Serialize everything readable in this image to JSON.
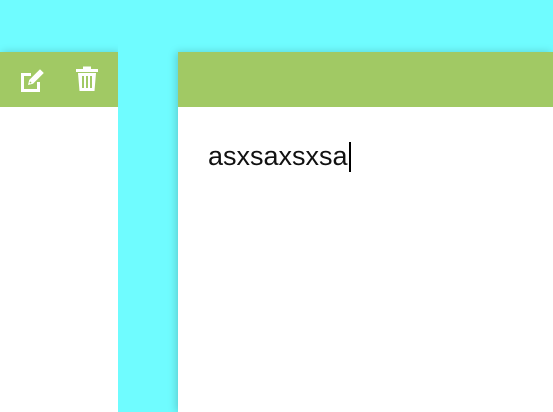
{
  "theme": {
    "background": "#6ffcff",
    "toolbar": "#a1c964",
    "panel": "#ffffff",
    "icon": "#ffffff",
    "text": "#111111"
  },
  "left_toolbar": {
    "icons": [
      "edit-icon",
      "trash-icon"
    ]
  },
  "editor": {
    "value": "asxsaxsxsa"
  }
}
